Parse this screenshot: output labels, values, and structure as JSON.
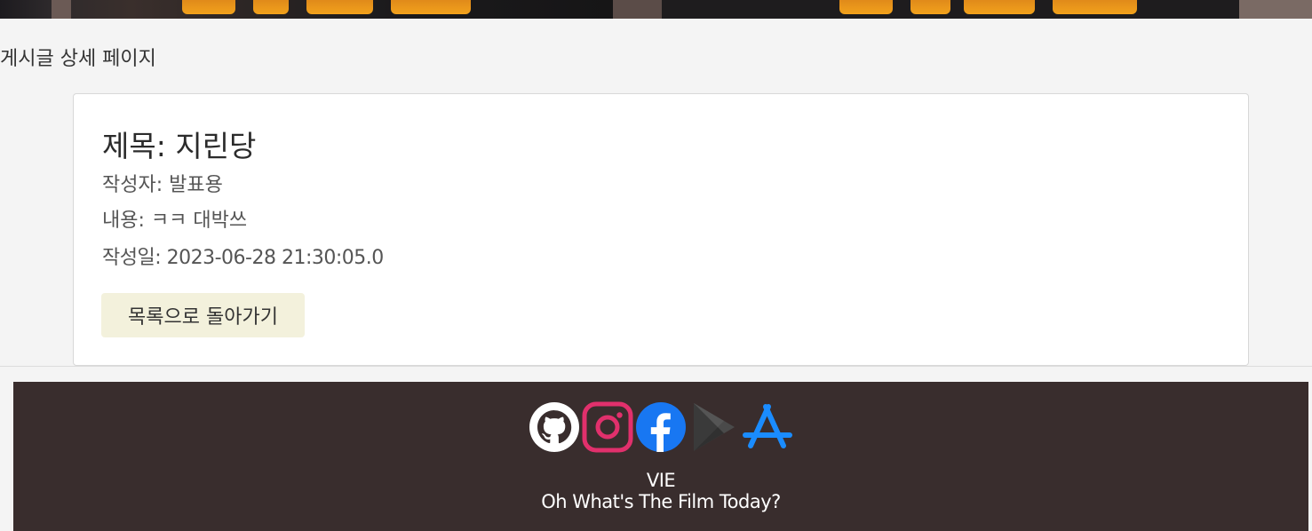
{
  "page": {
    "heading": "게시글 상세 페이지"
  },
  "post": {
    "title": "제목: 지린당",
    "author": "작성자: 발표용",
    "content": "내용: ㅋㅋ 대박쓰",
    "created_at": "작성일: 2023-06-28 21:30:05.0",
    "back_label": "목록으로 돌아가기"
  },
  "footer": {
    "brand": "VIE",
    "tagline": "Oh What's The Film Today?",
    "icons": [
      "github-icon",
      "instagram-icon",
      "facebook-icon",
      "google-play-icon",
      "app-store-icon"
    ]
  },
  "colors": {
    "background": "#f4f4f4",
    "card": "#ffffff",
    "button": "#f3f1dc",
    "footer": "#392d2d",
    "instagram": "#e1306c",
    "facebook": "#1877f2",
    "google_play": "#4a4a4a",
    "app_store": "#1a8cff"
  }
}
